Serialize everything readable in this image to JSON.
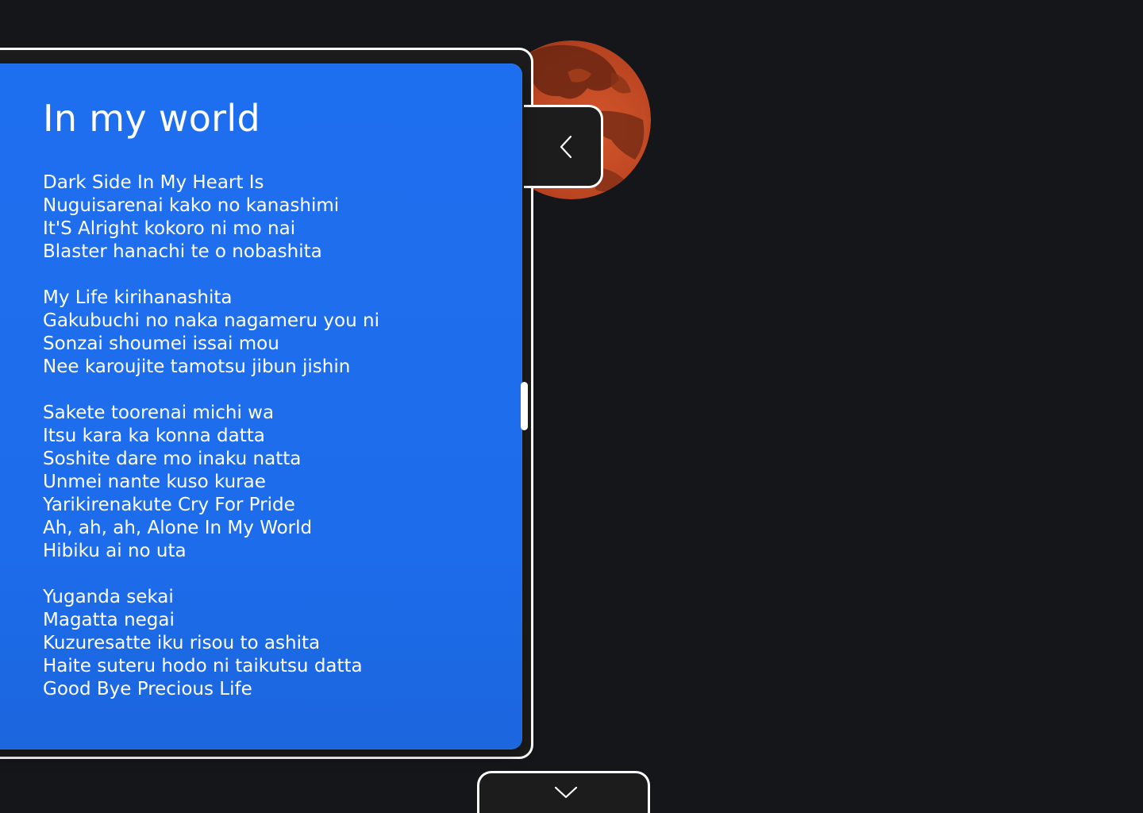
{
  "panel": {
    "title": "In my world",
    "stanzas": [
      [
        "Dark Side In My Heart Is",
        "Nuguisarenai kako no kanashimi",
        "It'S Alright kokoro ni mo nai",
        "Blaster hanachi te o nobashita"
      ],
      [
        "My Life kirihanashita",
        "Gakubuchi no naka nagameru you ni",
        "Sonzai shoumei issai mou",
        "Nee karoujite tamotsu jibun jishin"
      ],
      [
        "Sakete toorenai michi wa",
        "Itsu kara ka konna datta",
        "Soshite dare mo inaku natta",
        "Unmei nante kuso kurae",
        "Yarikirenakute Cry For Pride",
        "Ah, ah, ah, Alone In My World",
        "Hibiku ai no uta"
      ],
      [
        "Yuganda sekai",
        "Magatta negai",
        "Kuzuresatte iku risou to ashita",
        "Haite suteru hodo ni taikutsu datta",
        "Good Bye Precious Life"
      ]
    ]
  },
  "controls": {
    "collapse_icon": "chevron-left-icon",
    "expand_icon": "chevron-down-icon"
  },
  "colors": {
    "background": "#14161a",
    "panel": "#1e6ff0",
    "frame": "#1c1c1c",
    "outline": "#ffffff",
    "planet": "#c24a20"
  }
}
